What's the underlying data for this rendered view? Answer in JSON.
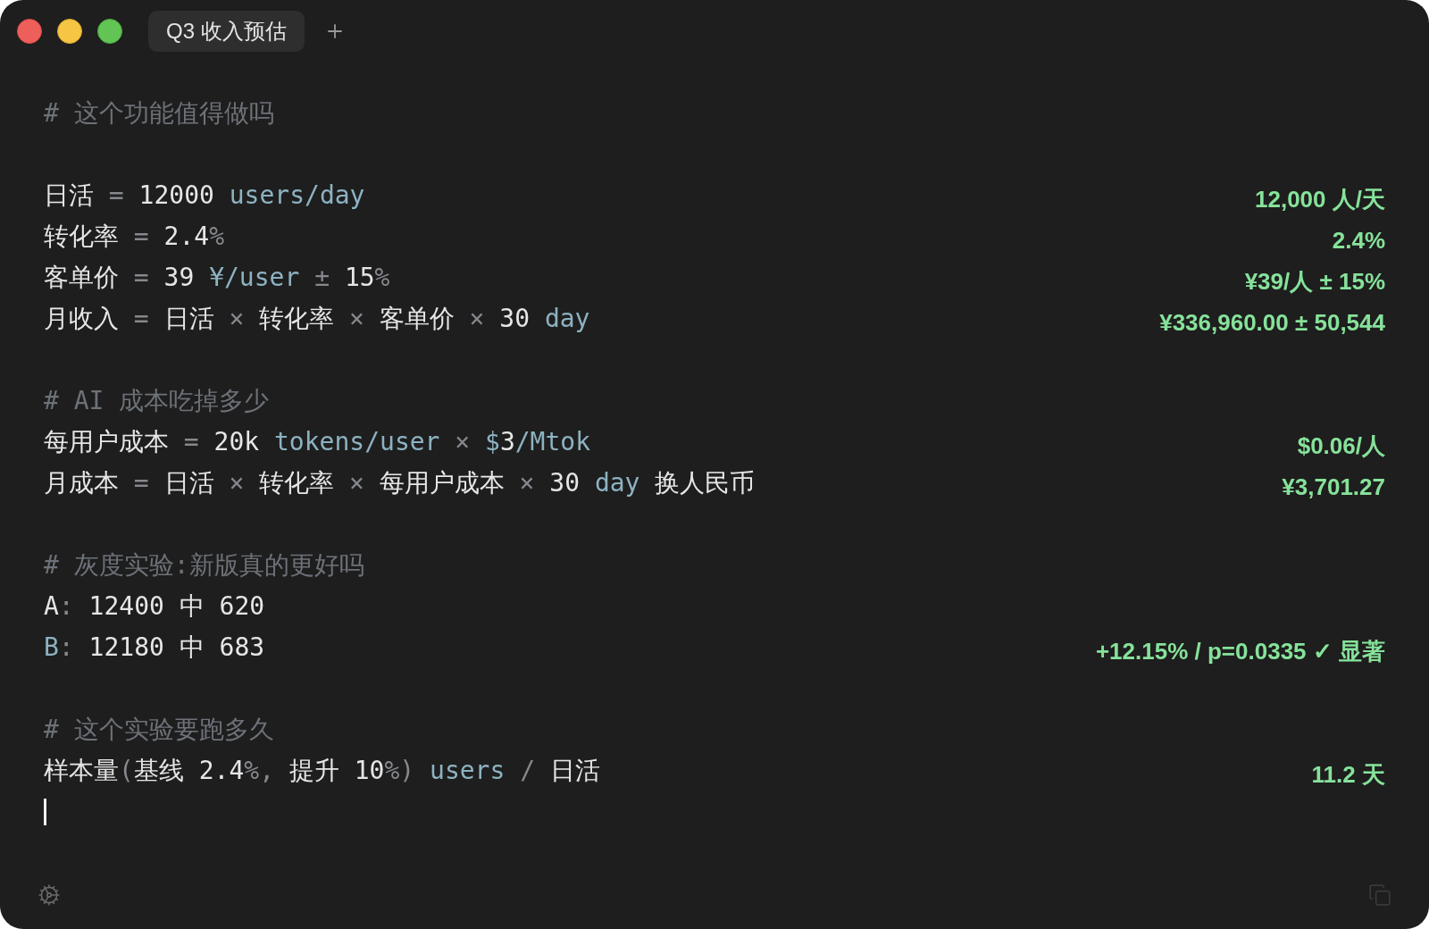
{
  "window": {
    "tabs": [
      {
        "label": "Q3 收入预估",
        "selected": true
      }
    ]
  },
  "editor": {
    "lines": [
      {
        "kind": "heading",
        "text": "# 这个功能值得做吗"
      },
      {
        "kind": "blank"
      },
      {
        "kind": "expr",
        "tokens": [
          {
            "text": "日活 ",
            "kind": "text"
          },
          {
            "text": "=",
            "kind": "op"
          },
          {
            "text": " 12000 ",
            "kind": "text"
          },
          {
            "text": "users/day",
            "kind": "unit"
          }
        ],
        "result": "12,000 人/天"
      },
      {
        "kind": "expr",
        "tokens": [
          {
            "text": "转化率 ",
            "kind": "text"
          },
          {
            "text": "=",
            "kind": "op"
          },
          {
            "text": " 2.4",
            "kind": "text"
          },
          {
            "text": "%",
            "kind": "op"
          }
        ],
        "result": "2.4%"
      },
      {
        "kind": "expr",
        "tokens": [
          {
            "text": "客单价 ",
            "kind": "text"
          },
          {
            "text": "=",
            "kind": "op"
          },
          {
            "text": " 39 ",
            "kind": "text"
          },
          {
            "text": "¥/user",
            "kind": "unit"
          },
          {
            "text": " ± ",
            "kind": "op"
          },
          {
            "text": "15",
            "kind": "text"
          },
          {
            "text": "%",
            "kind": "op"
          }
        ],
        "result": "¥39/人 ± 15%"
      },
      {
        "kind": "expr",
        "tokens": [
          {
            "text": "月收入 ",
            "kind": "text"
          },
          {
            "text": "=",
            "kind": "op"
          },
          {
            "text": " 日活 ",
            "kind": "text"
          },
          {
            "text": "×",
            "kind": "op"
          },
          {
            "text": " 转化率 ",
            "kind": "text"
          },
          {
            "text": "×",
            "kind": "op"
          },
          {
            "text": " 客单价 ",
            "kind": "text"
          },
          {
            "text": "×",
            "kind": "op"
          },
          {
            "text": " 30 ",
            "kind": "text"
          },
          {
            "text": "day",
            "kind": "unit"
          }
        ],
        "result": "¥336,960.00 ± 50,544"
      },
      {
        "kind": "blank"
      },
      {
        "kind": "heading",
        "text": "# AI 成本吃掉多少"
      },
      {
        "kind": "expr",
        "tokens": [
          {
            "text": "每用户成本 ",
            "kind": "text"
          },
          {
            "text": "=",
            "kind": "op"
          },
          {
            "text": " 20k ",
            "kind": "text"
          },
          {
            "text": "tokens/user",
            "kind": "unit"
          },
          {
            "text": " × ",
            "kind": "op"
          },
          {
            "text": "$",
            "kind": "unit"
          },
          {
            "text": "3",
            "kind": "text"
          },
          {
            "text": "/Mtok",
            "kind": "unit"
          }
        ],
        "result": "$0.06/人"
      },
      {
        "kind": "expr",
        "tokens": [
          {
            "text": "月成本 ",
            "kind": "text"
          },
          {
            "text": "=",
            "kind": "op"
          },
          {
            "text": " 日活 ",
            "kind": "text"
          },
          {
            "text": "×",
            "kind": "op"
          },
          {
            "text": " 转化率 ",
            "kind": "text"
          },
          {
            "text": "×",
            "kind": "op"
          },
          {
            "text": " 每用户成本 ",
            "kind": "text"
          },
          {
            "text": "×",
            "kind": "op"
          },
          {
            "text": " 30 ",
            "kind": "text"
          },
          {
            "text": "day",
            "kind": "unit"
          },
          {
            "text": " 换人民币",
            "kind": "text"
          }
        ],
        "result": "¥3,701.27"
      },
      {
        "kind": "blank"
      },
      {
        "kind": "heading",
        "text": "# 灰度实验:新版真的更好吗"
      },
      {
        "kind": "expr",
        "tokens": [
          {
            "text": "A",
            "kind": "text"
          },
          {
            "text": ":",
            "kind": "op"
          },
          {
            "text": " 12400 中 620",
            "kind": "text"
          }
        ]
      },
      {
        "kind": "expr",
        "tokens": [
          {
            "text": "B",
            "kind": "unit"
          },
          {
            "text": ":",
            "kind": "op"
          },
          {
            "text": " 12180 中 683",
            "kind": "text"
          }
        ],
        "result": "+12.15% / p=0.0335 ✓ 显著"
      },
      {
        "kind": "blank"
      },
      {
        "kind": "heading",
        "text": "# 这个实验要跑多久"
      },
      {
        "kind": "expr",
        "tokens": [
          {
            "text": "样本量",
            "kind": "text"
          },
          {
            "text": "(",
            "kind": "op"
          },
          {
            "text": "基线 2.4",
            "kind": "text"
          },
          {
            "text": "%,",
            "kind": "op"
          },
          {
            "text": " 提升 10",
            "kind": "text"
          },
          {
            "text": "%)",
            "kind": "op"
          },
          {
            "text": " users",
            "kind": "unit"
          },
          {
            "text": " / ",
            "kind": "op"
          },
          {
            "text": "日活",
            "kind": "text"
          }
        ],
        "result": "11.2 天"
      },
      {
        "kind": "cursor"
      }
    ]
  }
}
